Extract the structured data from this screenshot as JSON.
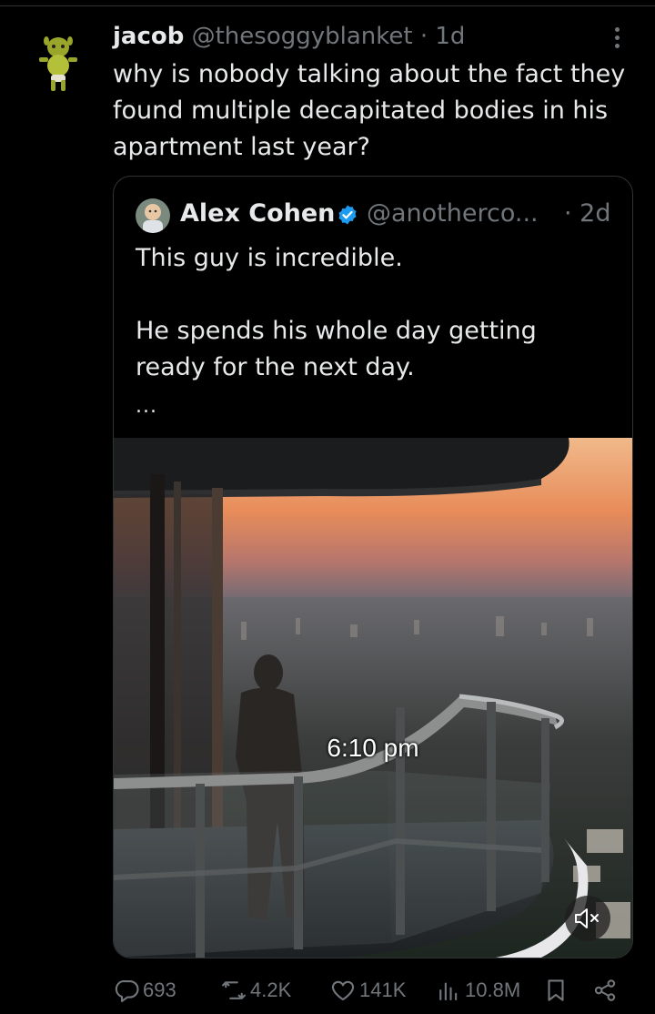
{
  "post": {
    "author_name": "jacob",
    "handle": "@thesoggyblanket",
    "separator": "·",
    "time": "1d",
    "text": "why is nobody talking about the fact they found multiple decapitated bodies in his apartment last year?"
  },
  "quote": {
    "author_name": "Alex Cohen",
    "handle": "@anotherco...",
    "time": "· 2d",
    "line1": "This guy is incredible.",
    "line2": "He spends his whole day getting ready for the next day.",
    "ellipsis": "...",
    "video_caption": "6:10 pm"
  },
  "actions": {
    "replies": "693",
    "reposts": "4.2K",
    "likes": "141K",
    "views": "10.8M"
  },
  "icons": [
    "reply-icon",
    "repost-icon",
    "like-icon",
    "views-icon",
    "bookmark-icon",
    "share-icon",
    "more-icon",
    "verified-badge-icon",
    "mute-icon"
  ],
  "colors": {
    "background": "#000000",
    "text": "#e7e9ea",
    "muted": "#71767b",
    "verified": "#1d9bf0",
    "border": "#2f3336"
  }
}
